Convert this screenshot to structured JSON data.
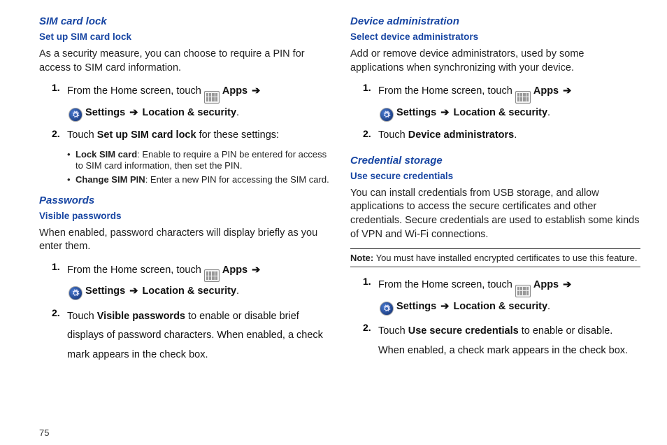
{
  "page_number": "75",
  "nav": {
    "from_home": "From the Home screen, touch",
    "apps": "Apps",
    "settings": "Settings",
    "loc_sec": "Location & security"
  },
  "left": {
    "sim_heading": "SIM card lock",
    "sim_sub": "Set up SIM card lock",
    "sim_intro": "As a security measure, you can choose to require a PIN for access to SIM card information.",
    "sim_step2_a": "Touch ",
    "sim_step2_bold": "Set up SIM card lock",
    "sim_step2_b": " for these settings:",
    "bullet1_bold": "Lock SIM card",
    "bullet1_rest": ": Enable to require a PIN be entered for access to SIM card information, then set the PIN.",
    "bullet2_bold": "Change SIM  PIN",
    "bullet2_rest": ": Enter a new PIN for accessing the SIM card.",
    "pw_heading": "Passwords",
    "pw_sub": "Visible passwords",
    "pw_intro": "When enabled, password characters will display briefly as you enter them.",
    "pw_step2_a": "Touch ",
    "pw_step2_bold": "Visible passwords",
    "pw_step2_b": " to enable or disable brief displays of password characters. When enabled, a check mark appears in the check box."
  },
  "right": {
    "dev_heading": "Device administration",
    "dev_sub": "Select device administrators",
    "dev_intro": "Add or remove device administrators, used by some applications when synchronizing with your device.",
    "dev_step2_a": "Touch ",
    "dev_step2_bold": "Device administrators",
    "dev_step2_b": ".",
    "cred_heading": "Credential storage",
    "cred_sub": "Use secure credentials",
    "cred_intro": "You can install credentials from USB storage, and allow applications to access the secure certificates and other credentials. Secure credentials are used to establish some kinds of VPN and Wi-Fi connections.",
    "note_bold": "Note:",
    "note_text": " You must have installed encrypted certificates to use this feature.",
    "cred_step2_a": "Touch ",
    "cred_step2_bold": "Use secure credentials",
    "cred_step2_b": " to enable or disable. When enabled, a check mark appears in the check box."
  }
}
